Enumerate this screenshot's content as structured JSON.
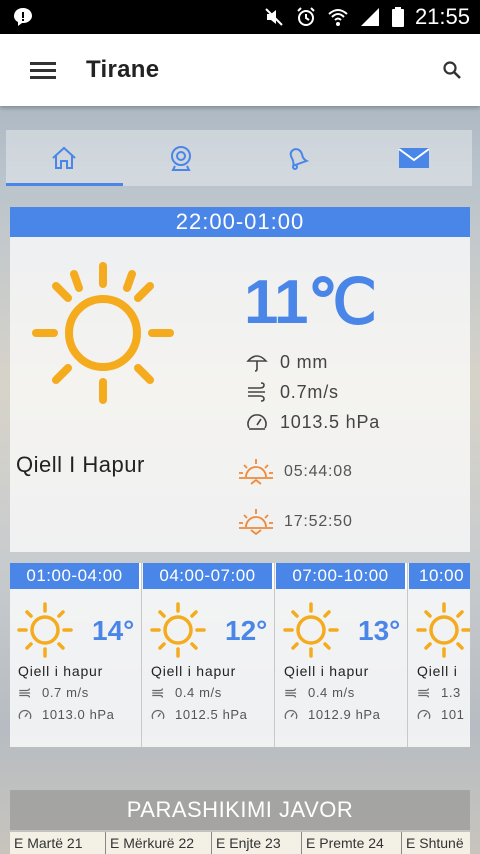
{
  "status_bar": {
    "time": "21:55",
    "icons": [
      "notification-icon",
      "mute-icon",
      "alarm-icon",
      "wifi-icon",
      "signal-icon",
      "battery-icon"
    ]
  },
  "app_bar": {
    "title": "Tirane",
    "menu_icon": "hamburger-menu-icon",
    "search_icon": "search-icon"
  },
  "tabs": [
    {
      "icon": "home-icon",
      "active": true
    },
    {
      "icon": "webcam-icon",
      "active": false
    },
    {
      "icon": "bell-icon",
      "active": false
    },
    {
      "icon": "mail-icon",
      "active": false
    }
  ],
  "current": {
    "period": "22:00-01:00",
    "temperature": "11℃",
    "condition": "Qiell I Hapur",
    "precipitation": "0 mm",
    "wind": "0.7m/s",
    "pressure": "1013.5 hPa",
    "sunrise": "05:44:08",
    "sunset": "17:52:50"
  },
  "hourly": [
    {
      "period": "01:00-04:00",
      "temp": "14°",
      "condition": "Qiell i hapur",
      "wind": "0.7 m/s",
      "pressure": "1013.0 hPa"
    },
    {
      "period": "04:00-07:00",
      "temp": "12°",
      "condition": "Qiell i hapur",
      "wind": "0.4 m/s",
      "pressure": "1012.5 hPa"
    },
    {
      "period": "07:00-10:00",
      "temp": "13°",
      "condition": "Qiell i hapur",
      "wind": "0.4 m/s",
      "pressure": "1012.9 hPa"
    },
    {
      "period": "10:00",
      "temp": "",
      "condition": "Qiell i",
      "wind": "1.3",
      "pressure": "101"
    }
  ],
  "weekly": {
    "title": "PARASHIKIMI JAVOR",
    "days": [
      "E Martë 21",
      "E Mërkurë 22",
      "E Enjte 23",
      "E Premte 24",
      "E Shtunë"
    ]
  },
  "colors": {
    "accent": "#4a86e8",
    "sun": "#f5ab1e",
    "sunrise_icon": "#ee8a3c"
  }
}
